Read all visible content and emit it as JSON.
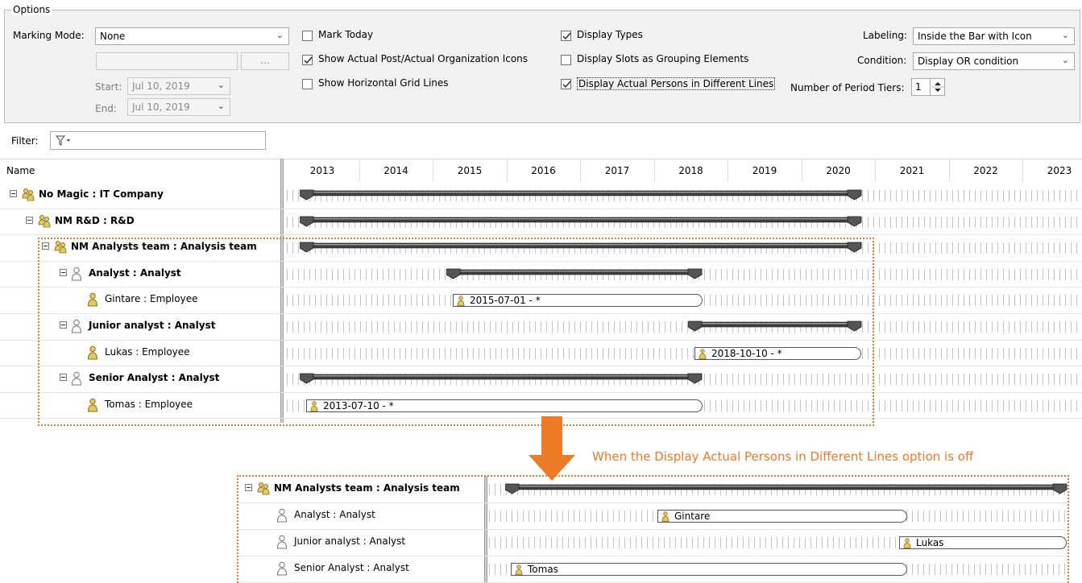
{
  "options": {
    "group_title": "Options",
    "marking_mode_label": "Marking Mode:",
    "marking_mode_value": "None",
    "browse_button_label": "...",
    "start_label": "Start:",
    "start_value": "Jul 10, 2019",
    "end_label": "End:",
    "end_value": "Jul 10, 2019",
    "checkboxes": [
      {
        "label": "Mark Today",
        "checked": false
      },
      {
        "label": "Show Actual Post/Actual Organization Icons",
        "checked": true
      },
      {
        "label": "Show Horizontal Grid Lines",
        "checked": false
      },
      {
        "label": "Display Types",
        "checked": true
      },
      {
        "label": "Display Slots as Grouping Elements",
        "checked": false
      },
      {
        "label": "Display Actual Persons in Different Lines",
        "checked": true
      }
    ],
    "labeling_label": "Labeling:",
    "labeling_value": "Inside the Bar with Icon",
    "condition_label": "Condition:",
    "condition_value": "Display OR condition",
    "tiers_label": "Number of Period Tiers:",
    "tiers_value": "1"
  },
  "filter": {
    "label": "Filter:",
    "icon": "funnel-icon"
  },
  "tree": {
    "column_header": "Name",
    "rows": [
      {
        "label": "No Magic : IT Company",
        "bold": true,
        "icon": "organization-icon",
        "expandable": true
      },
      {
        "label": "NM R&D : R&D",
        "bold": true,
        "icon": "organization-icon",
        "expandable": true
      },
      {
        "label": "NM Analysts team : Analysis team",
        "bold": true,
        "icon": "organization-icon",
        "expandable": true
      },
      {
        "label": "Analyst : Analyst",
        "bold": true,
        "icon": "post-icon",
        "expandable": true
      },
      {
        "label": "Gintare : Employee",
        "bold": false,
        "icon": "person-icon",
        "expandable": false
      },
      {
        "label": "Junior analyst : Analyst",
        "bold": true,
        "icon": "post-icon",
        "expandable": true
      },
      {
        "label": "Lukas : Employee",
        "bold": false,
        "icon": "person-icon",
        "expandable": false
      },
      {
        "label": "Senior Analyst : Analyst",
        "bold": true,
        "icon": "post-icon",
        "expandable": true
      },
      {
        "label": "Tomas : Employee",
        "bold": false,
        "icon": "person-icon",
        "expandable": false
      }
    ]
  },
  "timeline": {
    "years": [
      "2013",
      "2014",
      "2015",
      "2016",
      "2017",
      "2018",
      "2019",
      "2020",
      "2021",
      "2022",
      "2023"
    ],
    "actual_bars": [
      "2015-07-01 - *",
      "2018-10-10 - *",
      "2013-07-10 - *"
    ]
  },
  "annotation": {
    "note": "When the Display Actual Persons in Different Lines option is off"
  },
  "inset": {
    "rows": [
      {
        "label": "NM Analysts team : Analysis team",
        "bold": true,
        "icon": "organization-icon"
      },
      {
        "label": "Analyst : Analyst",
        "bold": false,
        "icon": "post-icon"
      },
      {
        "label": "Junior analyst : Analyst",
        "bold": false,
        "icon": "post-icon"
      },
      {
        "label": "Senior Analyst : Analyst",
        "bold": false,
        "icon": "post-icon"
      }
    ],
    "bar_labels": [
      "Gintare",
      "Lukas",
      "Tomas"
    ]
  },
  "colors": {
    "accent": "#ec7a27",
    "person_icon": "#e7c65a",
    "bar_dark": "#3d3d3d"
  }
}
